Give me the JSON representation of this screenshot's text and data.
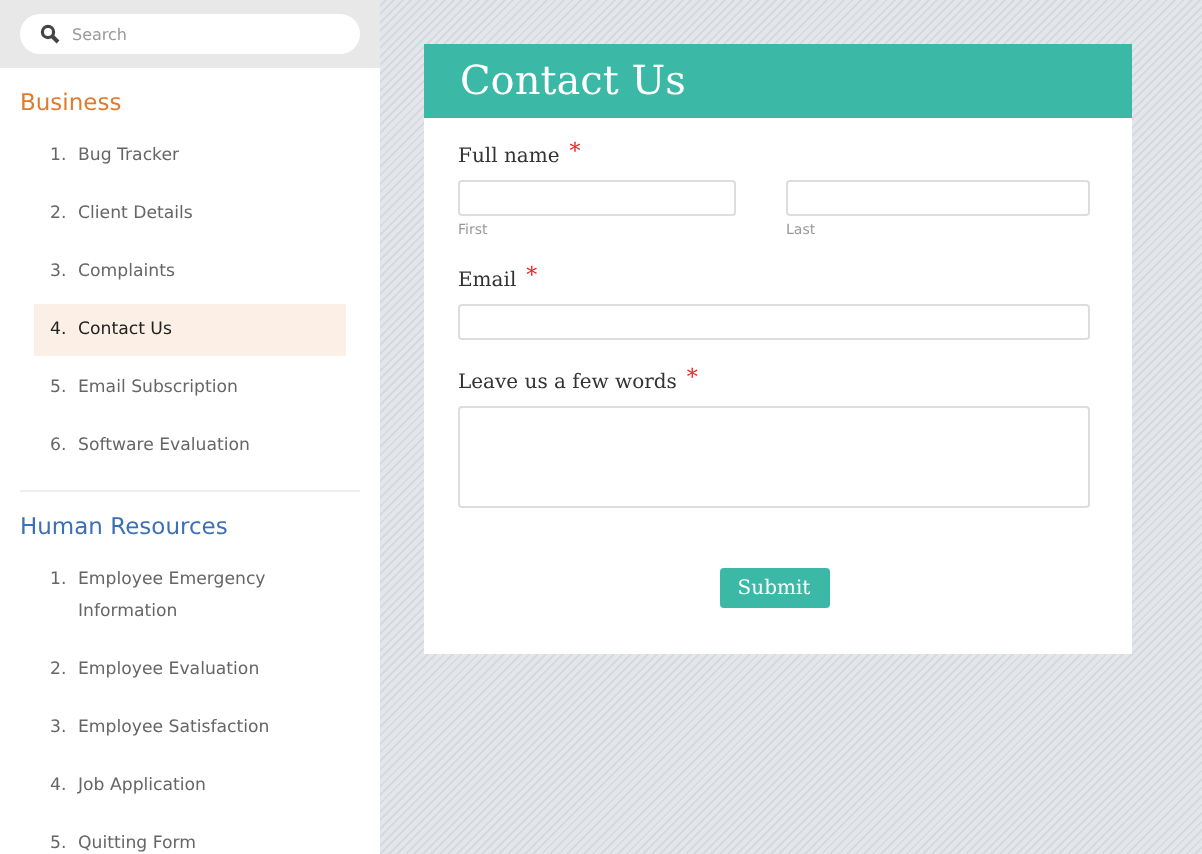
{
  "sidebar": {
    "search": {
      "placeholder": "Search"
    },
    "sections": [
      {
        "title": "Business",
        "color": "#e07a2e",
        "items": [
          {
            "number": "1.",
            "label": "Bug Tracker",
            "selected": false
          },
          {
            "number": "2.",
            "label": "Client Details",
            "selected": false
          },
          {
            "number": "3.",
            "label": "Complaints",
            "selected": false
          },
          {
            "number": "4.",
            "label": "Contact Us",
            "selected": true
          },
          {
            "number": "5.",
            "label": "Email Subscription",
            "selected": false
          },
          {
            "number": "6.",
            "label": "Software Evaluation",
            "selected": false
          }
        ]
      },
      {
        "title": "Human Resources",
        "color": "#3b6fb6",
        "items": [
          {
            "number": "1.",
            "label": "Employee Emergency Information",
            "selected": false
          },
          {
            "number": "2.",
            "label": "Employee Evaluation",
            "selected": false
          },
          {
            "number": "3.",
            "label": "Employee Satisfaction",
            "selected": false
          },
          {
            "number": "4.",
            "label": "Job Application",
            "selected": false
          },
          {
            "number": "5.",
            "label": "Quitting Form",
            "selected": false
          }
        ]
      }
    ]
  },
  "form": {
    "title": "Contact Us",
    "fields": [
      {
        "kind": "name",
        "label": "Full name",
        "required": true,
        "sublabels": [
          "First",
          "Last"
        ]
      },
      {
        "kind": "email",
        "label": "Email",
        "required": true
      },
      {
        "kind": "textarea",
        "label": "Leave us a few words",
        "required": true
      }
    ],
    "required_mark": "*",
    "submit": "Submit"
  }
}
